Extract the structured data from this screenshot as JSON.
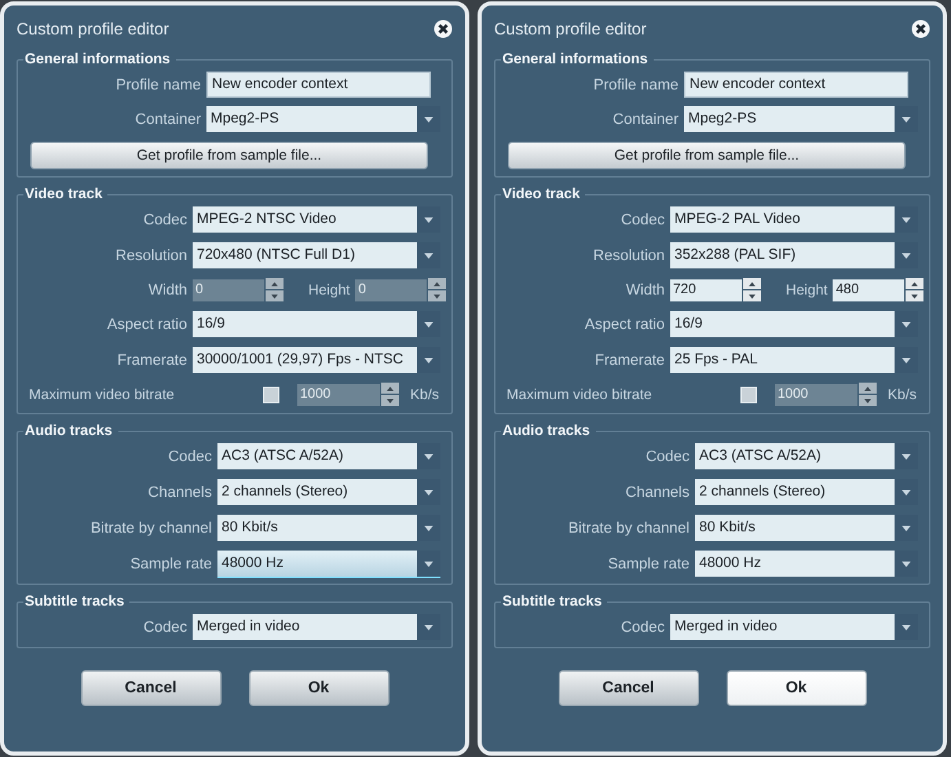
{
  "dialogs": [
    {
      "title": "Custom profile editor",
      "sections": [
        {
          "title": "General informations",
          "rows": [
            {
              "kind": "text",
              "label": "Profile name",
              "value": "New encoder context"
            },
            {
              "kind": "dropdown",
              "label": "Container",
              "value": "Mpeg2-PS",
              "focused": false
            },
            {
              "kind": "button",
              "label": "Get profile from sample file..."
            }
          ]
        },
        {
          "title": "Video track",
          "rows": [
            {
              "kind": "dropdown",
              "label": "Codec",
              "value": "MPEG-2 NTSC Video",
              "focused": false
            },
            {
              "kind": "dropdown",
              "label": "Resolution",
              "value": "720x480 (NTSC Full D1)",
              "focused": false
            },
            {
              "kind": "dimensions",
              "label": "Width",
              "value": "0",
              "second_label": "Height",
              "second_value": "0",
              "disabled": true
            },
            {
              "kind": "dropdown",
              "label": "Aspect ratio",
              "value": "16/9",
              "focused": false
            },
            {
              "kind": "dropdown",
              "label": "Framerate",
              "value": "30000/1001 (29,97) Fps - NTSC",
              "focused": false
            },
            {
              "kind": "limit",
              "label": "Maximum video bitrate",
              "checked": false,
              "value": "1000",
              "unit": "Kb/s",
              "disabled": true
            }
          ]
        },
        {
          "title": "Audio tracks",
          "rows": [
            {
              "kind": "dropdown",
              "label": "Codec",
              "value": "AC3 (ATSC A/52A)",
              "focused": false
            },
            {
              "kind": "dropdown",
              "label": "Channels",
              "value": "2 channels (Stereo)",
              "focused": false
            },
            {
              "kind": "dropdown",
              "label": "Bitrate by channel",
              "value": "80 Kbit/s",
              "focused": false
            },
            {
              "kind": "dropdown",
              "label": "Sample rate",
              "value": "48000 Hz",
              "focused": true
            }
          ]
        },
        {
          "title": "Subtitle tracks",
          "rows": [
            {
              "kind": "dropdown",
              "label": "Codec",
              "value": "Merged in video",
              "focused": false
            }
          ]
        }
      ],
      "buttons": [
        {
          "label": "Cancel",
          "focused": false
        },
        {
          "label": "Ok",
          "focused": false
        }
      ]
    },
    {
      "title": "Custom profile editor",
      "sections": [
        {
          "title": "General informations",
          "rows": [
            {
              "kind": "text",
              "label": "Profile name",
              "value": "New encoder context"
            },
            {
              "kind": "dropdown",
              "label": "Container",
              "value": "Mpeg2-PS",
              "focused": false
            },
            {
              "kind": "button",
              "label": "Get profile from sample file..."
            }
          ]
        },
        {
          "title": "Video track",
          "rows": [
            {
              "kind": "dropdown",
              "label": "Codec",
              "value": "MPEG-2 PAL Video",
              "focused": false
            },
            {
              "kind": "dropdown",
              "label": "Resolution",
              "value": "352x288 (PAL SIF)",
              "focused": false
            },
            {
              "kind": "dimensions",
              "label": "Width",
              "value": "720",
              "second_label": "Height",
              "second_value": "480",
              "disabled": false
            },
            {
              "kind": "dropdown",
              "label": "Aspect ratio",
              "value": "16/9",
              "focused": false
            },
            {
              "kind": "dropdown",
              "label": "Framerate",
              "value": "25 Fps - PAL",
              "focused": false
            },
            {
              "kind": "limit",
              "label": "Maximum video bitrate",
              "checked": false,
              "value": "1000",
              "unit": "Kb/s",
              "disabled": true
            }
          ]
        },
        {
          "title": "Audio tracks",
          "rows": [
            {
              "kind": "dropdown",
              "label": "Codec",
              "value": "AC3 (ATSC A/52A)",
              "focused": false
            },
            {
              "kind": "dropdown",
              "label": "Channels",
              "value": "2 channels (Stereo)",
              "focused": false
            },
            {
              "kind": "dropdown",
              "label": "Bitrate by channel",
              "value": "80 Kbit/s",
              "focused": false
            },
            {
              "kind": "dropdown",
              "label": "Sample rate",
              "value": "48000 Hz",
              "focused": false
            }
          ]
        },
        {
          "title": "Subtitle tracks",
          "rows": [
            {
              "kind": "dropdown",
              "label": "Codec",
              "value": "Merged in video",
              "focused": false
            }
          ]
        }
      ],
      "buttons": [
        {
          "label": "Cancel",
          "focused": false
        },
        {
          "label": "Ok",
          "focused": true
        }
      ]
    }
  ]
}
